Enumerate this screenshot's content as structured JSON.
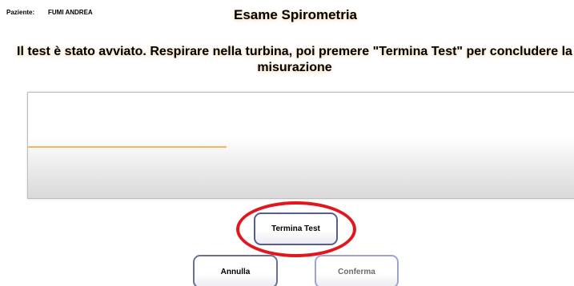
{
  "header": {
    "patient_label": "Paziente:",
    "patient_name": "FUMI ANDREA",
    "title": "Esame Spirometria"
  },
  "instruction": {
    "text": "Il test è stato avviato. Respirare nella turbina, poi premere \"Termina Test\" per concludere la misurazione"
  },
  "chart": {
    "trace_color": "#f0a030",
    "trace_level": 0.51,
    "trace_extent": 0.36
  },
  "buttons": {
    "termina_label": "Termina Test",
    "annulla_label": "Annulla",
    "conferma_label": "Conferma",
    "conferma_enabled": false
  },
  "annotation": {
    "ring_color": "#e3161d"
  }
}
